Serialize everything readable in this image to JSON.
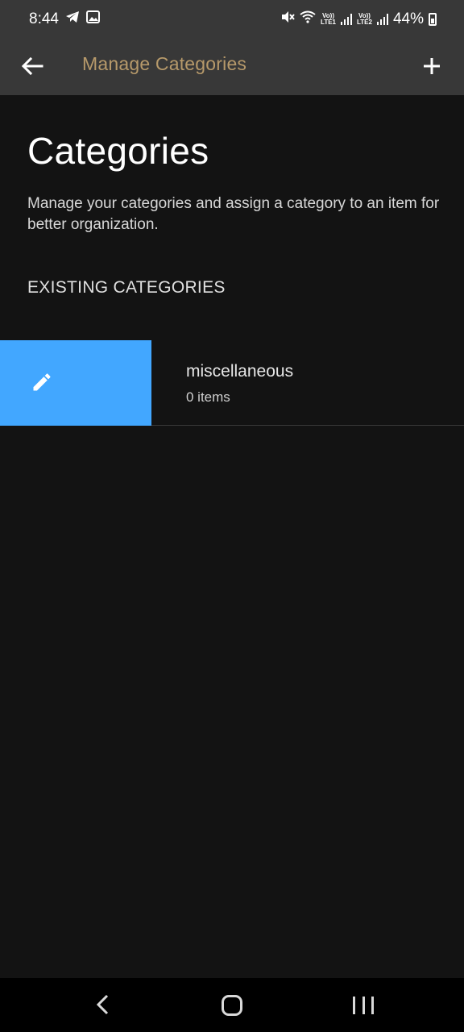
{
  "status_bar": {
    "time": "8:44",
    "lte1": "LTE1",
    "lte2": "LTE2",
    "volte1": "Vo))",
    "volte2": "Vo))",
    "battery": "44%"
  },
  "app_bar": {
    "title": "Manage Categories",
    "back_icon": "arrow-left-icon",
    "add_icon": "plus-icon"
  },
  "page": {
    "heading": "Categories",
    "description": "Manage your categories and assign a category to an item for better organization.",
    "section_label": "EXISTING CATEGORIES"
  },
  "categories": [
    {
      "name": "miscellaneous",
      "count": "0 items"
    }
  ],
  "colors": {
    "accent": "#b6996a",
    "edit_action": "#42a7ff",
    "background": "#131313",
    "bar": "#383838"
  }
}
